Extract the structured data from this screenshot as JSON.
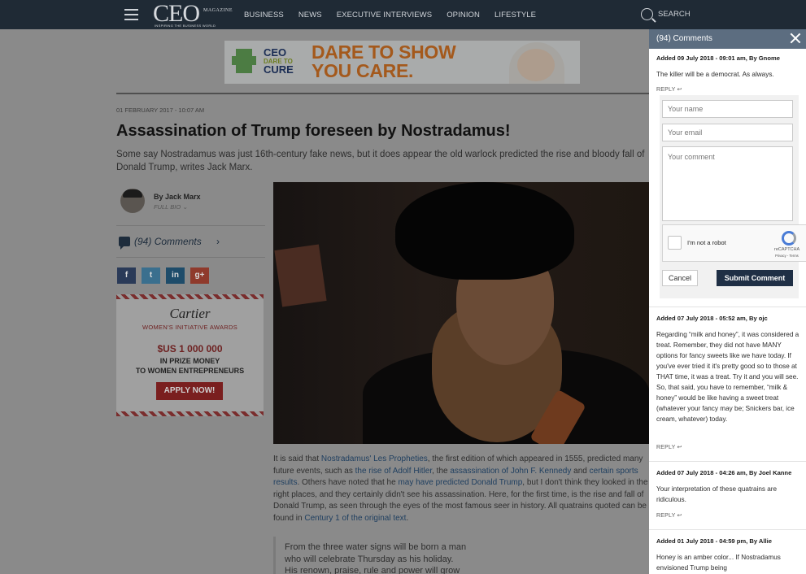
{
  "header": {
    "logo_text": "CEO",
    "logo_magazine": "MAGAZINE",
    "logo_tagline": "INSPIRING THE BUSINESS WORLD",
    "nav": [
      "BUSINESS",
      "NEWS",
      "EXECUTIVE INTERVIEWS",
      "OPINION",
      "LIFESTYLE"
    ],
    "search_label": "SEARCH"
  },
  "banner_ad": {
    "brand_line1": "CEO",
    "brand_line2": "DARE TO",
    "brand_line3": "CURE",
    "headline_1": "DARE TO SHOW",
    "headline_2": "YOU CARE."
  },
  "article": {
    "date": "01 FEBRUARY 2017 - 10:07 AM",
    "title": "Assassination of Trump foreseen by Nostradamus!",
    "standfirst": "Some say Nostradamus was just 16th-century fake news, but it does appear the old warlock predicted the rise and bloody fall of Donald Trump, writes Jack Marx.",
    "author": "By Jack Marx",
    "full_bio": "FULL BIO",
    "comments_count": "(94)",
    "comments_label": "Comments",
    "share": {
      "facebook": "f",
      "twitter": "t",
      "linkedin": "in",
      "google": "g+"
    },
    "body": {
      "p1_a": "It is said that ",
      "p1_link1": "Nostradamus' Les Propheties",
      "p1_b": ", the first edition of which appeared in 1555, predicted many future events, such as ",
      "p1_link2": "the rise of Adolf Hitler",
      "p1_c": ", the ",
      "p1_link3": "assassination of John F. Kennedy",
      "p1_d": " and ",
      "p1_link4": "certain sports results",
      "p1_e": ". Others have noted that he ",
      "p1_link5": "may have predicted Donald Trump",
      "p1_f": ", but I don't think they looked in the right places, and they certainly didn't see his assassination. Here, for the first time, is the rise and fall of Donald Trump, as seen through the eyes of the most famous seer in history. All quatrains quoted can be found in ",
      "p1_link6": "Century 1 of the original text",
      "p1_g": "."
    },
    "quote": "From the three water signs will be born a man\nwho will celebrate Thursday as his holiday.\nHis renown, praise, rule and power will grow"
  },
  "side_ad": {
    "brand": "Cartier",
    "program": "WOMEN'S INITIATIVE AWARDS",
    "amount": "$US 1 000 000",
    "line1": "IN PRIZE MONEY",
    "line2": "TO WOMEN ENTREPRENEURS",
    "cta": "APPLY NOW!"
  },
  "comments_panel": {
    "title": "(94) Comments",
    "reply_label": "REPLY",
    "form": {
      "name_placeholder": "Your name",
      "email_placeholder": "Your email",
      "comment_placeholder": "Your comment",
      "captcha_label": "I'm not a robot",
      "captcha_brand": "reCAPTCHA",
      "captcha_terms": "Privacy - Terms",
      "cancel": "Cancel",
      "submit": "Submit Comment"
    },
    "comments": [
      {
        "meta": "Added 09 July 2018 - 09:01 am, By Gnome",
        "text": "The killer will be a democrat. As always."
      },
      {
        "meta": "Added 07 July 2018 - 05:52 am, By ojc",
        "text": "Regarding “milk and honey”, it was considered a treat. Remember, they did not have MANY options for fancy sweets like we have today. If you've ever tried it it's pretty good so to those at THAT time, it was a treat. Try it and you will see. So, that said, you have to remember, “milk & honey” would be like having a sweet treat (whatever your fancy may be; Snickers bar, ice cream, whatever) today."
      },
      {
        "meta": "Added 07 July 2018 - 04:26 am, By Joel Kanne",
        "text": "Your interpretation of these quatrains are ridiculous."
      },
      {
        "meta": "Added 01 July 2018 - 04:59 pm, By Allie",
        "text": "Honey is an amber color... If Nostradamus envisioned Trump being"
      }
    ]
  }
}
